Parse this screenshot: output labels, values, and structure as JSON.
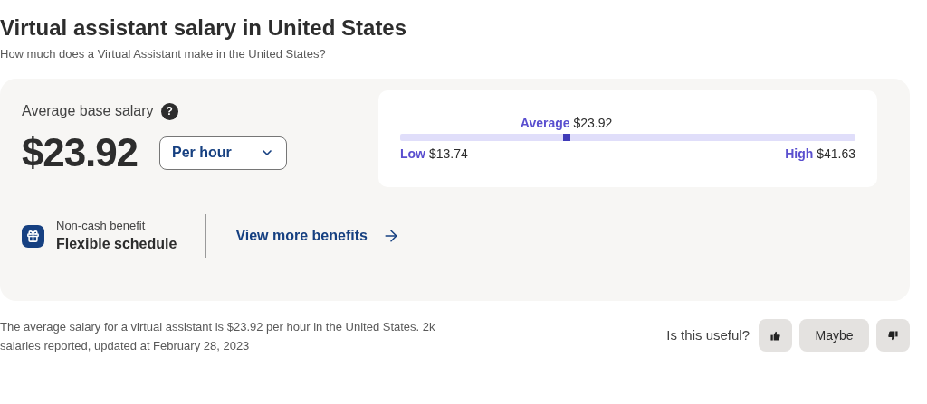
{
  "title": "Virtual assistant salary in United States",
  "subtitle": "How much does a Virtual Assistant make in the United States?",
  "salary": {
    "label": "Average base salary",
    "help": "?",
    "amount": "$23.92",
    "period": "Per hour"
  },
  "range": {
    "average_label": "Average",
    "average_value": "$23.92",
    "level": 0.365,
    "low_label": "Low",
    "low_value": "$13.74",
    "high_label": "High",
    "high_value": "$41.63"
  },
  "benefit": {
    "caption": "Non-cash benefit",
    "name": "Flexible schedule",
    "link": "View more benefits"
  },
  "summary": "The average salary for a virtual assistant is $23.92 per hour in the United States.  2k salaries reported, updated at February 28, 2023",
  "feedback": {
    "question": "Is this useful?",
    "buttons": [
      {
        "kind": "up"
      },
      {
        "kind": "text",
        "label": "Maybe"
      },
      {
        "kind": "down"
      }
    ]
  }
}
